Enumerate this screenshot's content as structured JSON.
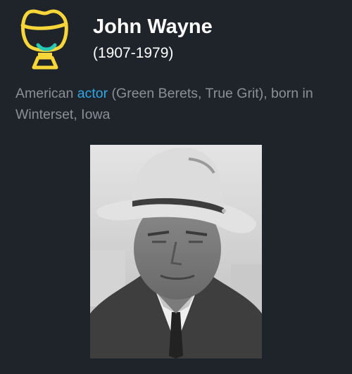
{
  "person": {
    "name": "John Wayne",
    "years": "(1907-1979)"
  },
  "description": {
    "prefix": "American ",
    "link_text": "actor",
    "suffix": " (Green Berets, True Grit), born in Winterset, Iowa"
  },
  "icons": {
    "bust": "bust-icon"
  },
  "colors": {
    "background": "#1f232a",
    "accent_yellow": "#f7d63a",
    "accent_teal": "#27c9b6",
    "link": "#2fa8e8",
    "body_text": "#8a9099"
  }
}
